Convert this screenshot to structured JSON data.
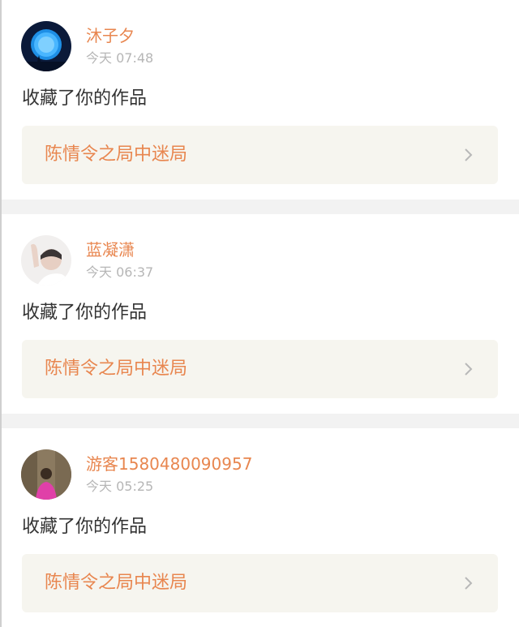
{
  "notifications": [
    {
      "username": "沐子夕",
      "time": "今天 07:48",
      "action": "收藏了你的作品",
      "work_title": "陈情令之局中迷局",
      "avatar_icon": "moon-night-avatar-icon"
    },
    {
      "username": "蓝凝潇",
      "time": "今天 06:37",
      "action": "收藏了你的作品",
      "work_title": "陈情令之局中迷局",
      "avatar_icon": "person-waving-avatar-icon"
    },
    {
      "username": "游客1580480090957",
      "time": "今天 05:25",
      "action": "收藏了你的作品",
      "work_title": "陈情令之局中迷局",
      "avatar_icon": "person-photo-avatar-icon"
    }
  ],
  "colors": {
    "accent": "#e8864f",
    "muted": "#b6b6b6",
    "card_bg": "#f6f5ef",
    "divider": "#f2f2f2",
    "text": "#333333"
  }
}
